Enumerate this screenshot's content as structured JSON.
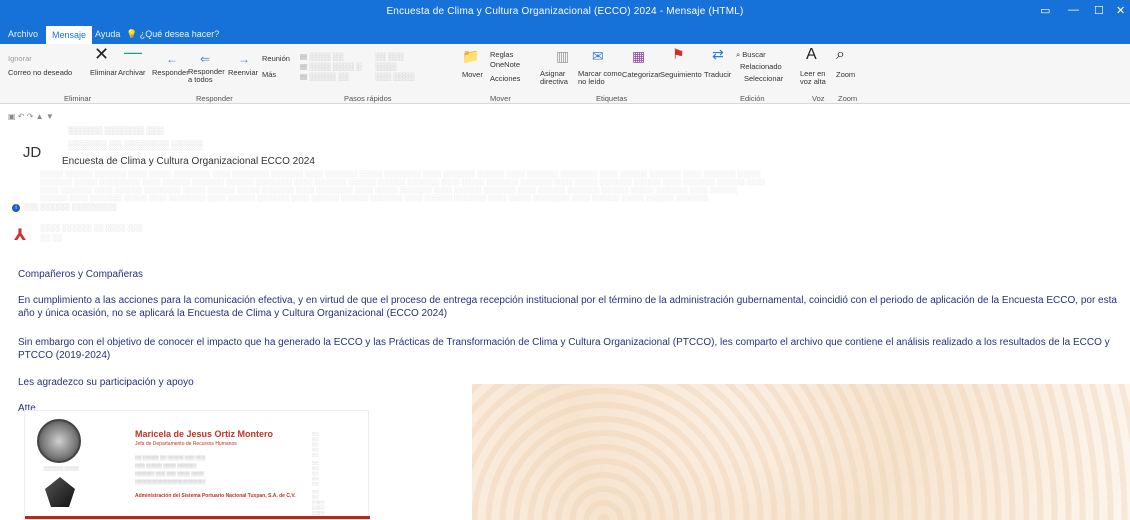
{
  "window": {
    "title": "Encuesta de Clima y Cultura Organizacional (ECCO) 2024 - Mensaje (HTML)"
  },
  "menu": {
    "items": [
      "Archivo",
      "Mensaje",
      "Ayuda",
      "¿Qué desea hacer?"
    ]
  },
  "ribbon": {
    "ignorar": "Ignorar",
    "correo_no_deseado": "Correo no deseado",
    "eliminar": "Eliminar",
    "archivar": "Archivar",
    "responder": "Responder",
    "responder_a_todos": "Responder a todos",
    "reenviar": "Reenviar",
    "reunion": "Reunión",
    "mas": "Más",
    "mover": "Mover",
    "reglas": "Reglas",
    "onenote": "OneNote",
    "acciones": "Acciones",
    "asignar_directiva": "Asignar directiva",
    "marcar_como_no_leido": "Marcar como no leído",
    "categorizar": "Categorizar",
    "seguimiento": "Seguimiento",
    "traducir": "Traducir",
    "buscar": "Buscar",
    "relacionado": "Relacionado",
    "seleccionar": "Seleccionar",
    "leer_en_voz_alta": "Leer en voz alta",
    "zoom": "Zoom",
    "group_eliminar": "Eliminar",
    "group_responder": "Responder",
    "group_pasos_rapidos": "Pasos rápidos",
    "group_mover": "Mover",
    "group_etiquetas": "Etiquetas",
    "group_edicion": "Edición",
    "group_voz": "Voz",
    "group_zoom": "Zoom"
  },
  "email": {
    "avatar_initials": "JD",
    "subject": "Encuesta de Clima y Cultura Organizacional ECCO 2024",
    "greeting": "Compañeros y Compañeras",
    "para1": "En cumplimiento a las acciones para la comunicación efectiva, y en virtud de que el proceso de entrega recepción institucional por el término de la administración gubernamental, coincidió con el periodo de aplicación de la Encuesta ECCO, por esta año y única ocasión, no se aplicará la Encuesta de Clima y Cultura Organizacional (ECCO 2024)",
    "para2": "Sin embargo con el objetivo de conocer el impacto que ha generado la ECCO y las Prácticas de Transformación de Clima y Cultura Organizacional (PTCCO), les comparto el archivo que contiene el análisis realizado a los resultados de la ECCO y PTCCO (2019-2024)",
    "thanks": "Les agradezco su participación y apoyo",
    "closing": "Atte"
  },
  "signature": {
    "name": "Maricela de Jesus Ortiz Montero",
    "role": "Jefa de Departamento de Recursos Humanos",
    "org": "Administración del Sistema Portuario Nacional Tuxpan, S.A. de C.V."
  },
  "colors": {
    "titlebar": "#1672d8",
    "body_text": "#26317d",
    "signature_red": "#c03426"
  }
}
